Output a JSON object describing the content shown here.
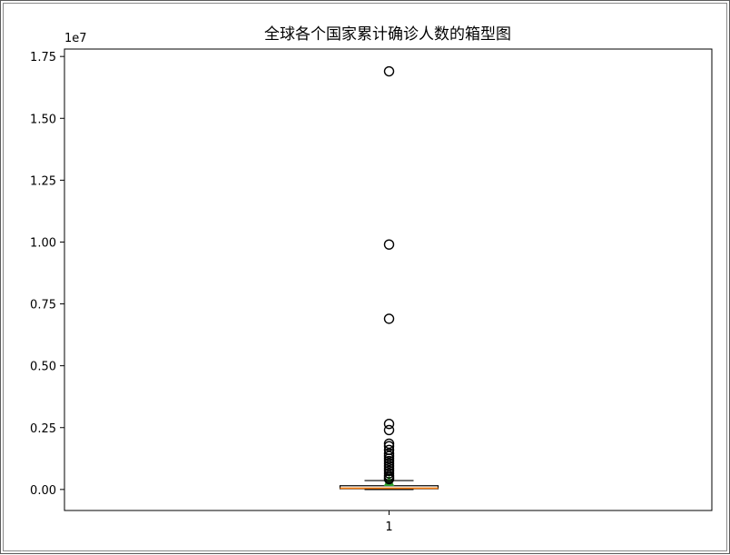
{
  "chart_data": {
    "type": "boxplot",
    "title": "全球各个国家累计确诊人数的箱型图",
    "xlabel": "",
    "ylabel": "",
    "offset_label": "1e7",
    "categories": [
      "1"
    ],
    "ylim": [
      -0.085,
      1.78
    ],
    "yticks": [
      0.0,
      0.25,
      0.5,
      0.75,
      1.0,
      1.25,
      1.5,
      1.75
    ],
    "ytick_labels": [
      "0.00",
      "0.25",
      "0.50",
      "0.75",
      "1.00",
      "1.25",
      "1.50",
      "1.75"
    ],
    "box": {
      "q1": 0.003,
      "median": 0.005,
      "q3": 0.015,
      "whisker_low": 0.0,
      "whisker_high": 0.036,
      "mean": 0.03
    },
    "outliers": [
      1.69,
      0.99,
      0.69,
      0.265,
      0.24,
      0.185,
      0.175,
      0.16,
      0.145,
      0.135,
      0.125,
      0.115,
      0.105,
      0.095,
      0.085,
      0.075,
      0.065,
      0.055,
      0.048,
      0.042
    ],
    "grid": false,
    "colors": {
      "box": "#000000",
      "median": "#ff7f0e",
      "mean": "#2ca02c",
      "outlier": "#000000",
      "axes": "#000000"
    }
  }
}
